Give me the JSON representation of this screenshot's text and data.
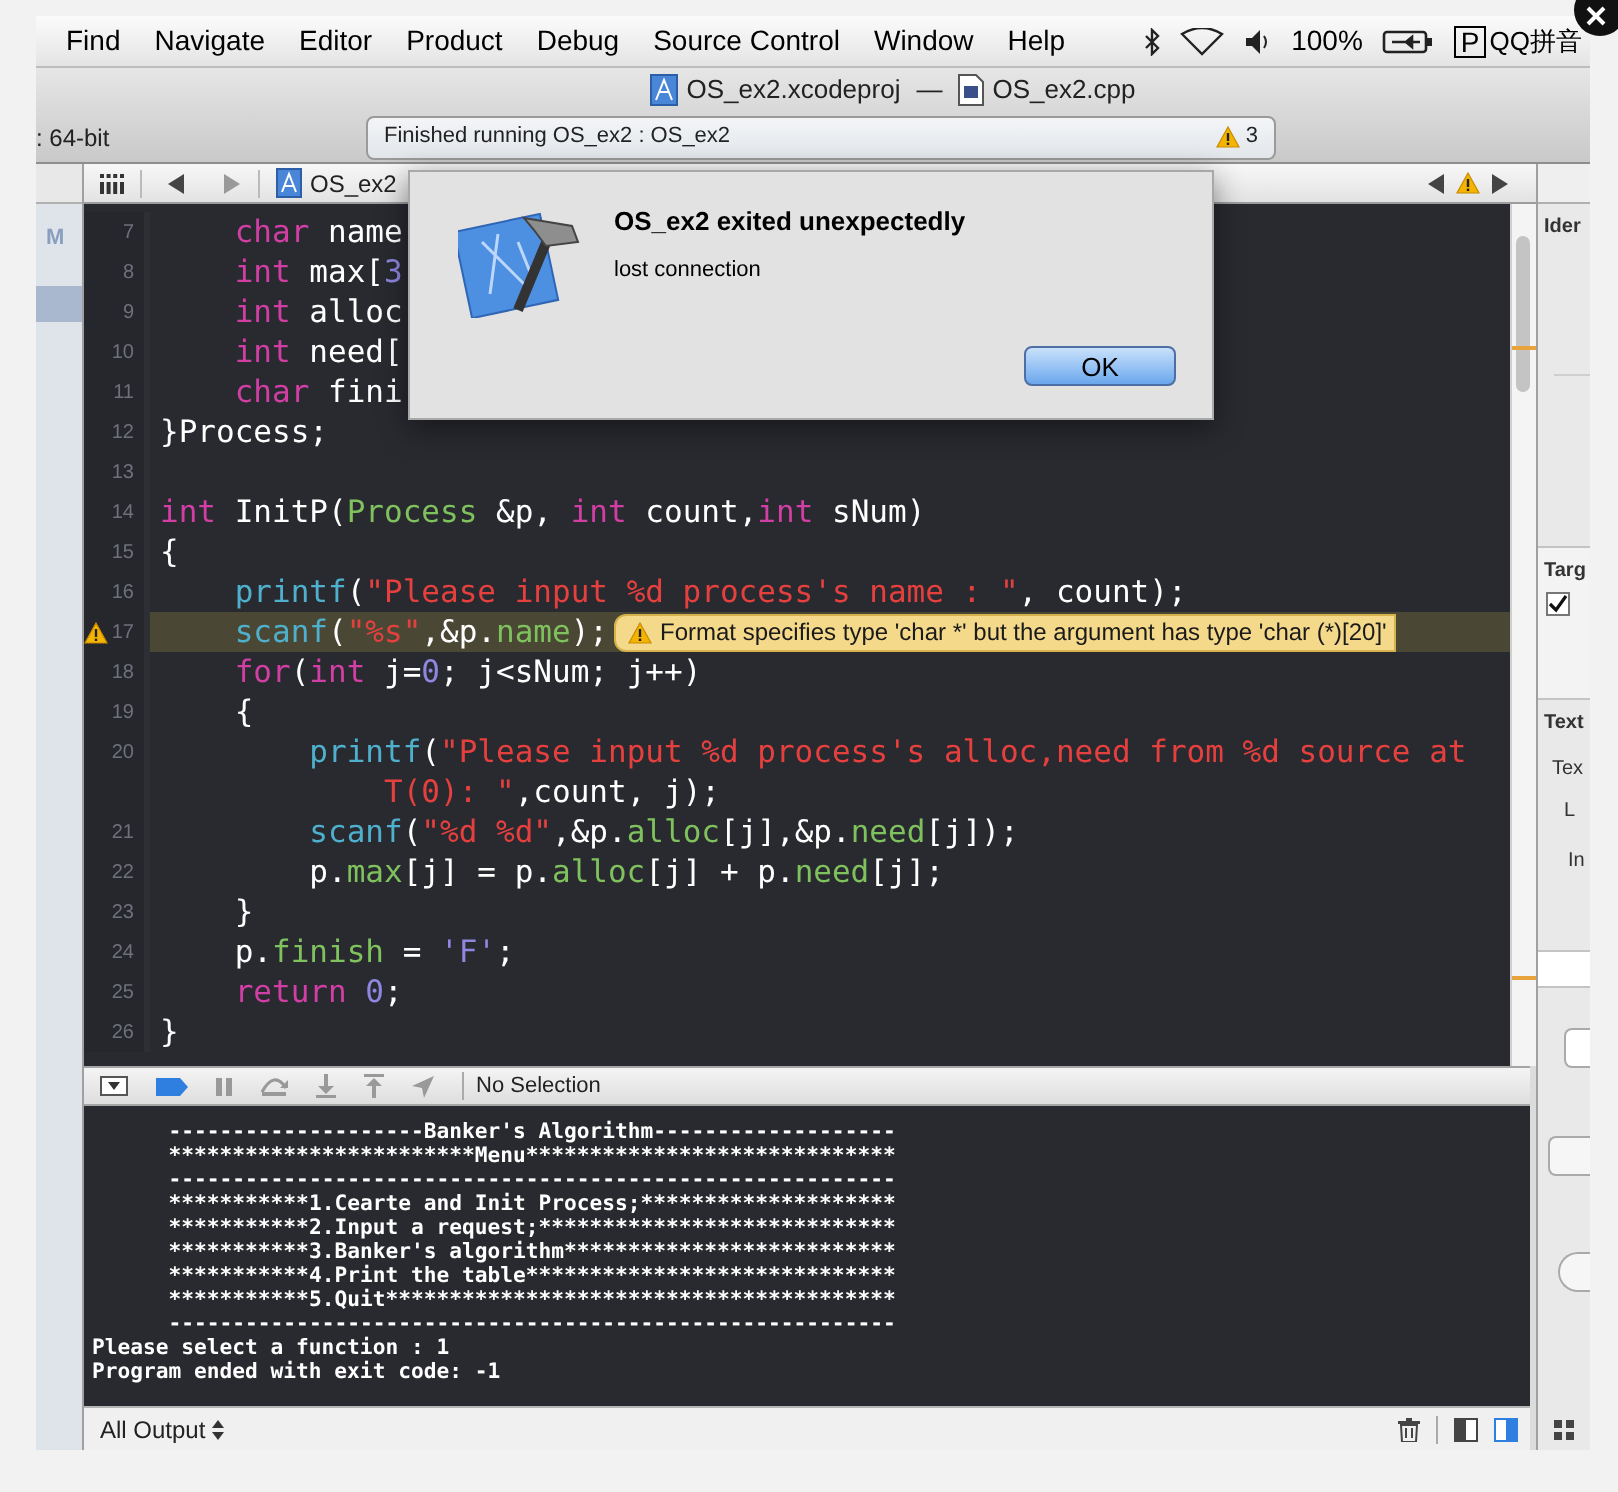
{
  "menu_bar": {
    "items": [
      "Find",
      "Navigate",
      "Editor",
      "Product",
      "Debug",
      "Source Control",
      "Window",
      "Help"
    ],
    "battery": "100%",
    "input_method_key": "P",
    "input_method": "QQ拼音"
  },
  "window": {
    "project": "OS_ex2.xcodeproj",
    "separator": "—",
    "file": "OS_ex2.cpp"
  },
  "toolbar": {
    "scheme_fragment": ": 64-bit",
    "status": "Finished running OS_ex2 : OS_ex2",
    "warning_count": "3"
  },
  "jump_bar": {
    "project": "OS_ex2"
  },
  "navigator": {
    "label": "M"
  },
  "editor": {
    "lines": [
      {
        "number": "7",
        "tokens": [
          {
            "kind": "keyword",
            "text": "    char"
          },
          {
            "kind": "plain",
            "text": " name"
          }
        ]
      },
      {
        "number": "8",
        "tokens": [
          {
            "kind": "keyword",
            "text": "    int"
          },
          {
            "kind": "plain",
            "text": " max["
          },
          {
            "kind": "number",
            "text": "3"
          }
        ]
      },
      {
        "number": "9",
        "tokens": [
          {
            "kind": "keyword",
            "text": "    int"
          },
          {
            "kind": "plain",
            "text": " alloc"
          }
        ]
      },
      {
        "number": "10",
        "tokens": [
          {
            "kind": "keyword",
            "text": "    int"
          },
          {
            "kind": "plain",
            "text": " need["
          }
        ]
      },
      {
        "number": "11",
        "tokens": [
          {
            "kind": "keyword",
            "text": "    char"
          },
          {
            "kind": "plain",
            "text": " fini"
          }
        ]
      },
      {
        "number": "12",
        "tokens": [
          {
            "kind": "plain",
            "text": "}Process;"
          }
        ]
      },
      {
        "number": "13"
      },
      {
        "number": "14",
        "tokens": [
          {
            "kind": "keyword",
            "text": "int"
          },
          {
            "kind": "plain",
            "text": " InitP("
          },
          {
            "kind": "type",
            "text": "Process"
          },
          {
            "kind": "plain",
            "text": " &p, "
          },
          {
            "kind": "keyword",
            "text": "int"
          },
          {
            "kind": "plain",
            "text": " count,"
          },
          {
            "kind": "keyword",
            "text": "int"
          },
          {
            "kind": "plain",
            "text": " sNum)"
          }
        ]
      },
      {
        "number": "15",
        "tokens": [
          {
            "kind": "plain",
            "text": "{"
          }
        ]
      },
      {
        "number": "16",
        "tokens": [
          {
            "kind": "function",
            "text": "    printf"
          },
          {
            "kind": "plain",
            "text": "("
          },
          {
            "kind": "string",
            "text": "\"Please input %d process's name : \""
          },
          {
            "kind": "plain",
            "text": ", count);"
          }
        ]
      },
      {
        "number": "17",
        "warning": "Format specifies type 'char *' but the argument has type 'char (*)[20]'",
        "tokens": [
          {
            "kind": "function",
            "text": "    scanf"
          },
          {
            "kind": "plain",
            "text": "("
          },
          {
            "kind": "string",
            "text": "\"%s\""
          },
          {
            "kind": "plain",
            "text": ",&p."
          },
          {
            "kind": "member",
            "text": "name"
          },
          {
            "kind": "plain",
            "text": ");"
          }
        ]
      },
      {
        "number": "18",
        "tokens": [
          {
            "kind": "keyword",
            "text": "    for"
          },
          {
            "kind": "plain",
            "text": "("
          },
          {
            "kind": "keyword",
            "text": "int"
          },
          {
            "kind": "plain",
            "text": " j="
          },
          {
            "kind": "number",
            "text": "0"
          },
          {
            "kind": "plain",
            "text": "; j<sNum; j++)"
          }
        ]
      },
      {
        "number": "19",
        "tokens": [
          {
            "kind": "plain",
            "text": "    {"
          }
        ]
      },
      {
        "number": "20",
        "tokens": [
          {
            "kind": "function",
            "text": "        printf"
          },
          {
            "kind": "plain",
            "text": "("
          },
          {
            "kind": "string",
            "text": "\"Please input %d process's alloc,need from %d source at"
          }
        ],
        "continuation": [
          {
            "kind": "string",
            "text": "T(0): \""
          },
          {
            "kind": "plain",
            "text": ",count, j);"
          }
        ]
      },
      {
        "number": "21",
        "tokens": [
          {
            "kind": "function",
            "text": "        scanf"
          },
          {
            "kind": "plain",
            "text": "("
          },
          {
            "kind": "string",
            "text": "\"%d %d\""
          },
          {
            "kind": "plain",
            "text": ",&p."
          },
          {
            "kind": "member",
            "text": "alloc"
          },
          {
            "kind": "plain",
            "text": "[j],&p."
          },
          {
            "kind": "member",
            "text": "need"
          },
          {
            "kind": "plain",
            "text": "[j]);"
          }
        ]
      },
      {
        "number": "22",
        "tokens": [
          {
            "kind": "plain",
            "text": "        p."
          },
          {
            "kind": "member",
            "text": "max"
          },
          {
            "kind": "plain",
            "text": "[j] = p."
          },
          {
            "kind": "member",
            "text": "alloc"
          },
          {
            "kind": "plain",
            "text": "[j] + p."
          },
          {
            "kind": "member",
            "text": "need"
          },
          {
            "kind": "plain",
            "text": "[j];"
          }
        ]
      },
      {
        "number": "23",
        "tokens": [
          {
            "kind": "plain",
            "text": "    }"
          }
        ]
      },
      {
        "number": "24",
        "tokens": [
          {
            "kind": "plain",
            "text": "    p."
          },
          {
            "kind": "member",
            "text": "finish"
          },
          {
            "kind": "plain",
            "text": " = "
          },
          {
            "kind": "number",
            "text": "'F'"
          },
          {
            "kind": "plain",
            "text": ";"
          }
        ]
      },
      {
        "number": "25",
        "tokens": [
          {
            "kind": "keyword",
            "text": "    return"
          },
          {
            "kind": "number",
            "text": " 0"
          },
          {
            "kind": "plain",
            "text": ";"
          }
        ]
      },
      {
        "number": "26",
        "tokens": [
          {
            "kind": "plain",
            "text": "}"
          }
        ]
      }
    ]
  },
  "inspector": {
    "sections": [
      "Ider",
      "Targ",
      "Text"
    ],
    "target_checked": true,
    "labels": [
      "Tex",
      "L",
      "In"
    ]
  },
  "debug_bar": {
    "breakpoints_active": true,
    "selection": "No Selection"
  },
  "console": {
    "lines": [
      "\t--------------------Banker's Algorithm-------------------",
      "\t************************Menu*****************************",
      "\t---------------------------------------------------------",
      "\t***********1.Cearte and Init Process;********************",
      "\t***********2.Input a request;****************************",
      "\t***********3.Banker's algorithm**************************",
      "\t***********4.Print the table*****************************",
      "\t***********5.Quit****************************************",
      "\t---------------------------------------------------------",
      "Please select a function : 1",
      "Program ended with exit code: -1"
    ]
  },
  "console_footer": {
    "filter": "All Output",
    "panes": [
      {
        "selected": false
      },
      {
        "selected": true
      }
    ]
  },
  "dialog": {
    "title": "OS_ex2 exited unexpectedly",
    "message": "lost connection",
    "button": "OK"
  }
}
